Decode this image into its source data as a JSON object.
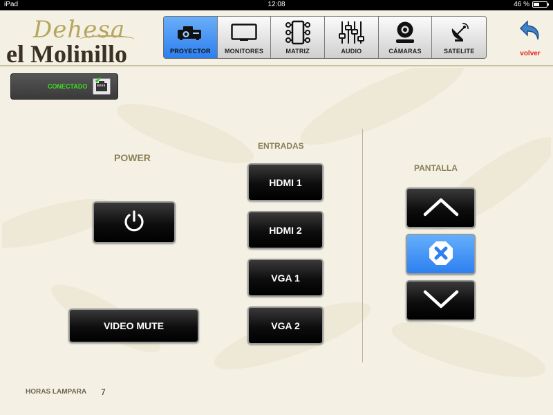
{
  "status_bar": {
    "device": "iPad",
    "time": "12:08",
    "battery": "46 %",
    "battery_level": 0.46
  },
  "logo": {
    "script": "Dehesa",
    "main": "el Molinillo"
  },
  "tabs": [
    {
      "label": "PROYECTOR",
      "icon": "projector-icon",
      "active": true
    },
    {
      "label": "MONITORES",
      "icon": "monitor-icon",
      "active": false
    },
    {
      "label": "MATRIZ",
      "icon": "matrix-icon",
      "active": false
    },
    {
      "label": "AUDIO",
      "icon": "audio-mixer-icon",
      "active": false
    },
    {
      "label": "CÁMARAS",
      "icon": "camera-icon",
      "active": false
    },
    {
      "label": "SATELITE",
      "icon": "satellite-dish-icon",
      "active": false
    }
  ],
  "back": {
    "label": "volver",
    "icon": "back-arrow-icon"
  },
  "connection": {
    "status": "CONECTADO",
    "icon": "network-port-icon"
  },
  "power": {
    "title": "POWER",
    "icon": "power-icon"
  },
  "video_mute": {
    "label": "VIDEO MUTE"
  },
  "inputs": {
    "title": "ENTRADAS",
    "items": [
      "HDMI 1",
      "HDMI 2",
      "VGA 1",
      "VGA 2"
    ]
  },
  "screen": {
    "title": "PANTALLA",
    "up_icon": "chevron-up-icon",
    "stop_icon": "stop-icon",
    "down_icon": "chevron-down-icon"
  },
  "lamp": {
    "label": "HORAS LAMPARA",
    "value": "7"
  },
  "colors": {
    "accent_blue": "#2e7ff0",
    "gold": "#8a7f55",
    "connected_green": "#3de01f",
    "back_red": "#e0241b"
  }
}
